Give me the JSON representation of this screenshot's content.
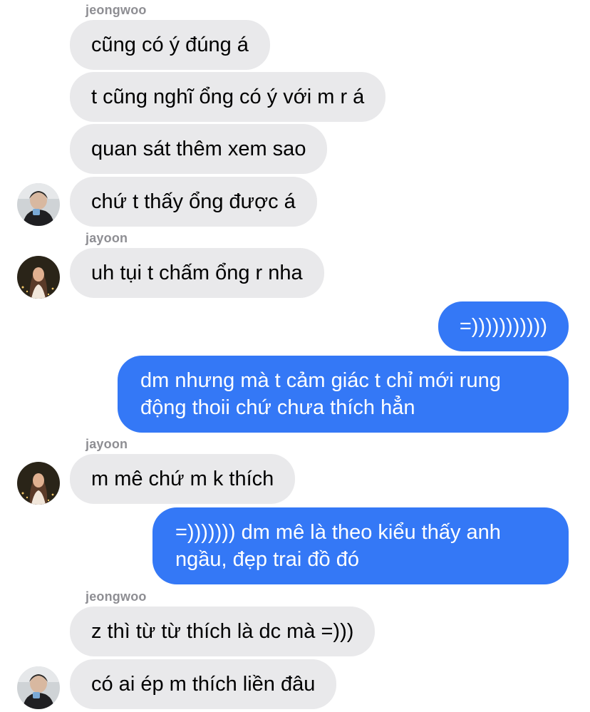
{
  "chat": {
    "messages": [
      {
        "sender_label": "jeongwoo",
        "text": "cũng có ý đúng á"
      },
      {
        "text": "t cũng nghĩ ổng có ý với m r á"
      },
      {
        "text": "quan sát thêm xem sao"
      },
      {
        "text": "chứ t thấy ổng được á",
        "avatar": "avatar-jeongwoo"
      },
      {
        "sender_label": "jayoon",
        "text": "uh tụi t chấm ổng r nha",
        "avatar": "avatar-jayoon"
      },
      {
        "text": "=)))))))))))",
        "outgoing": true
      },
      {
        "text": "dm nhưng mà t cảm giác t chỉ mới rung động thoii chứ chưa thích hẳn",
        "outgoing": true
      },
      {
        "sender_label": "jayoon",
        "text": "m mê chứ m k thích",
        "avatar": "avatar-jayoon"
      },
      {
        "text": "=))))))) dm mê là theo kiểu thấy anh ngầu, đẹp trai đồ đó",
        "outgoing": true
      },
      {
        "sender_label": "jeongwoo",
        "text": "z thì từ từ thích là dc mà =)))"
      },
      {
        "text": "có ai ép m thích liền đâu",
        "avatar": "avatar-jeongwoo"
      }
    ]
  },
  "colors": {
    "incoming_bubble": "#e9e9eb",
    "outgoing_bubble": "#3478f6",
    "sender_label": "#8e8e93"
  }
}
